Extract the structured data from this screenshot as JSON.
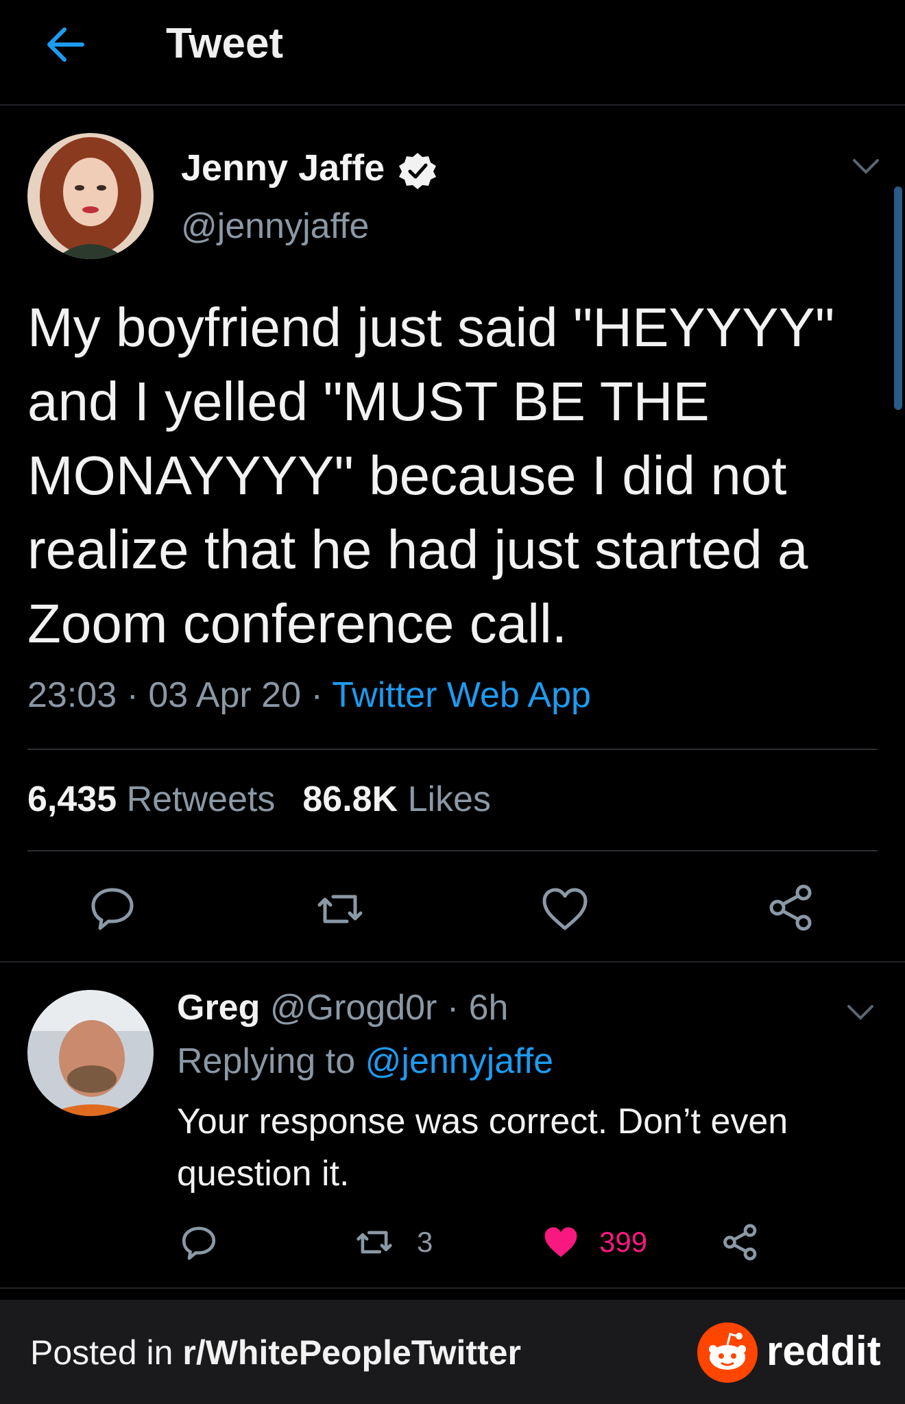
{
  "header": {
    "title": "Tweet"
  },
  "tweet": {
    "author_name": "Jenny Jaffe",
    "author_handle": "@jennyjaffe",
    "text": "My boyfriend just said \"HEYYYY\" and I yelled \"MUST BE THE MONAYYYY\" because I did not realize that he had just started a Zoom conference call.",
    "time": "23:03",
    "date": "03 Apr 20",
    "source": "Twitter Web App",
    "retweets_count": "6,435",
    "retweets_label": "Retweets",
    "likes_count": "86.8K",
    "likes_label": "Likes"
  },
  "reply": {
    "name": "Greg",
    "handle": "@Grogd0r",
    "age": "6h",
    "replying_to_label": "Replying to",
    "replying_to_handle": "@jennyjaffe",
    "text": "Your response was correct.  Don’t even question it.",
    "retweets": "3",
    "likes": "399"
  },
  "footer": {
    "posted_in": "Posted in",
    "subreddit": "r/WhitePeopleTwitter",
    "brand": "reddit"
  },
  "colors": {
    "accent": "#1d9bf0",
    "like": "#f91880",
    "reddit": "#ff4500",
    "muted": "#8b98a5"
  }
}
